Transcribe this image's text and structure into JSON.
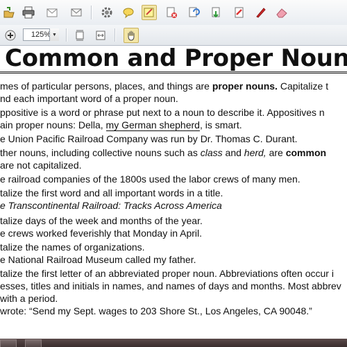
{
  "toolbar": {
    "zoom_value": "125%",
    "icons": [
      "open-icon",
      "print-icon",
      "email-icon",
      "settings-icon",
      "comment-icon",
      "highlight-icon",
      "delete-page-icon",
      "rotate-icon",
      "extract-icon",
      "edit-pdf-icon",
      "pen-icon",
      "eraser-icon"
    ]
  },
  "document": {
    "title": "Common and Proper Noun",
    "lines": [
      [
        "mes of particular persons, places, and things are ",
        "proper nouns.",
        " Capitalize t"
      ],
      [
        "nd each important word of a proper noun."
      ],
      [
        "ppositive is a word or phrase put next to a noun to describe it. Appositives n"
      ],
      [
        "ain proper nouns: Della, ",
        "my German shepherd",
        ", is smart."
      ],
      [
        "e Union Pacific Railroad Company was run by Dr. Thomas C. Durant."
      ],
      [
        "ther nouns, including collective nouns such as ",
        "class",
        " and ",
        "herd,",
        " are ",
        "common"
      ],
      [
        " are not capitalized."
      ],
      [
        "e railroad companies of the 1800s used the labor crews of many men."
      ],
      [
        "talize the first word and all important words in a title."
      ],
      [
        "e Transcontinental Railroad: Tracks Across America"
      ],
      [
        "talize days of the week and months of the year."
      ],
      [
        "e crews worked feverishly that Monday in April."
      ],
      [
        "talize the names of organizations."
      ],
      [
        "e National Railroad Museum called my father."
      ],
      [
        "talize the first letter of an abbreviated proper noun. Abbreviations often occur i"
      ],
      [
        "esses, titles and initials in names, and names of days and months. Most abbrev"
      ],
      [
        "with a period."
      ],
      [
        " wrote: “Send my Sept. wages to 203 Shore St., Los Angeles, CA  90048.”"
      ]
    ]
  }
}
